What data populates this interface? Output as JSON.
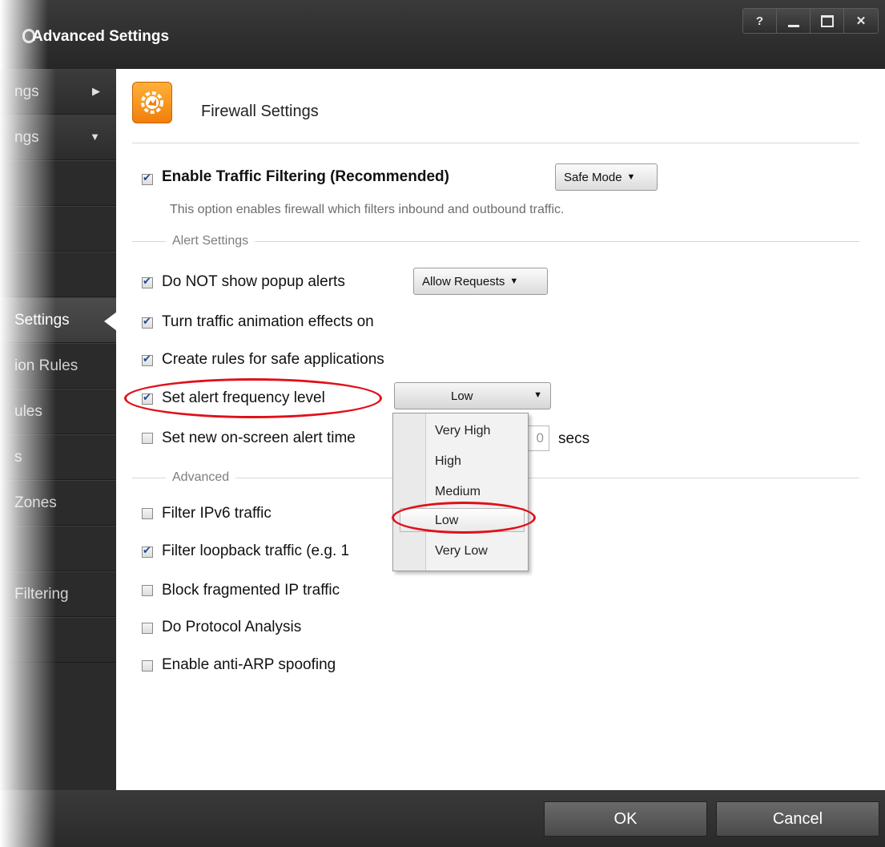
{
  "window": {
    "title": "Advanced Settings",
    "buttons": [
      "?",
      "",
      "",
      "✕"
    ]
  },
  "sidebar": {
    "items": [
      {
        "label": "ngs",
        "arrow": "▶"
      },
      {
        "label": "ngs",
        "arrow": "▼"
      },
      {
        "label": ""
      },
      {
        "label": ""
      },
      {
        "label": ""
      },
      {
        "label": "Settings"
      },
      {
        "label": "ion Rules"
      },
      {
        "label": "ules"
      },
      {
        "label": "s"
      },
      {
        "label": "Zones"
      },
      {
        "label": ""
      },
      {
        "label": "Filtering"
      },
      {
        "label": ""
      }
    ]
  },
  "panel": {
    "title": "Firewall Settings",
    "icon": "firewall-gear-icon"
  },
  "traffic": {
    "label": "Enable Traffic Filtering (Recommended)",
    "checked": true,
    "mode": "Safe Mode",
    "description": "This option enables firewall which filters inbound and outbound traffic."
  },
  "alert_settings": {
    "group_label": "Alert Settings",
    "options": [
      {
        "label": "Do NOT show popup alerts",
        "checked": true
      },
      {
        "label": "Turn traffic animation effects on",
        "checked": true
      },
      {
        "label": "Create rules for safe applications",
        "checked": true
      },
      {
        "label": "Set alert frequency level",
        "checked": true
      },
      {
        "label": "Set new on-screen alert time",
        "checked": false
      }
    ],
    "popup_dropdown": "Allow Requests",
    "frequency_value": "Low",
    "frequency_options": [
      "Very High",
      "High",
      "Medium",
      "Low",
      "Very Low"
    ],
    "timeout_value": "0",
    "timeout_unit": "secs"
  },
  "advanced": {
    "group_label": "Advanced",
    "options": [
      {
        "label": "Filter IPv6 traffic",
        "checked": false
      },
      {
        "label": "Filter loopback traffic (e.g. 1",
        "checked": true
      },
      {
        "label": "Block fragmented IP traffic",
        "checked": false
      },
      {
        "label": "Do Protocol Analysis",
        "checked": false
      },
      {
        "label": "Enable anti-ARP spoofing",
        "checked": false
      }
    ]
  },
  "footer": {
    "ok": "OK",
    "cancel": "Cancel"
  },
  "colors": {
    "highlight_ring": "#e0101a",
    "icon_orange": "#f59a1e",
    "chrome_dark": "#2b2b2b"
  }
}
